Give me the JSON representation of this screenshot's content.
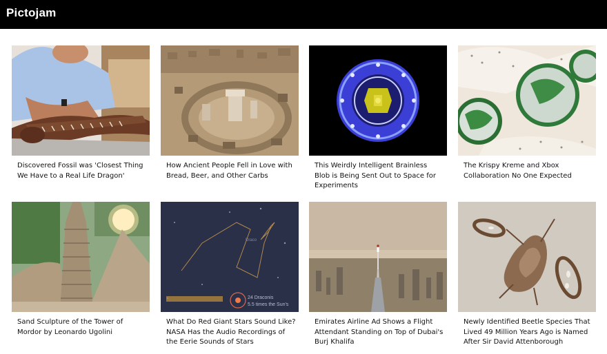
{
  "site": {
    "brand": "Pictojam"
  },
  "articles": [
    {
      "title": "Discovered Fossil was 'Closest Thing We Have to a Real Life Dragon'",
      "image": "man-with-pterosaur-skull"
    },
    {
      "title": "How Ancient People Fell in Love with Bread, Beer, and Other Carbs",
      "image": "stone-ruins-aerial"
    },
    {
      "title": "This Weirdly Intelligent Brainless Blob is Being Sent Out to Space for Experiments",
      "image": "glowing-petri-dish"
    },
    {
      "title": "The Krispy Kreme and Xbox Collaboration No One Expected",
      "image": "green-glazed-donuts"
    },
    {
      "title": "Sand Sculpture of the Tower of Mordor by Leonardo Ugolini",
      "image": "sand-sculpture-tower"
    },
    {
      "title": "What Do Red Giant Stars Sound Like? NASA Has the Audio Recordings of the Eerie Sounds of Stars",
      "image": "draco-constellation-map"
    },
    {
      "title": "Emirates Airline Ad Shows a Flight Attendant Standing on Top of Dubai's Burj Khalifa",
      "image": "burj-khalifa-summit"
    },
    {
      "title": "Newly Identified Beetle Species That Lived 49 Million Years Ago is Named After Sir David Attenborough",
      "image": "fossil-beetle"
    }
  ],
  "image_labels": {
    "constellation": "Draco",
    "star_name": "24 Draconis",
    "star_size": "5.5 times the Sun's"
  }
}
